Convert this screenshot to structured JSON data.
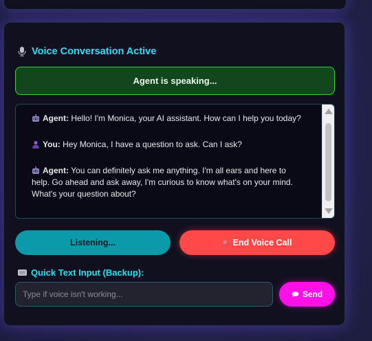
{
  "header": {
    "title": "Voice Conversation Active",
    "icon": "microphone-icon"
  },
  "status": {
    "text": "Agent is speaking..."
  },
  "transcript": {
    "messages": [
      {
        "speaker": "Agent:",
        "avatar": "robot-icon",
        "text": "Hello! I'm Monica, your AI assistant. How can I help you today?"
      },
      {
        "speaker": "You:",
        "avatar": "user-icon",
        "text": "Hey Monica, I have a question to ask. Can I ask?"
      },
      {
        "speaker": "Agent:",
        "avatar": "robot-icon",
        "text": "You can definitely ask me anything. I'm all ears and here to help. Go ahead and ask away, I'm curious to know what's on your mind. What's your question about?"
      }
    ]
  },
  "controls": {
    "listening_label": "Listening...",
    "end_call_label": "End Voice Call"
  },
  "quick_input": {
    "label": "Quick Text Input (Backup):",
    "placeholder": "Type if voice isn't working...",
    "value": "",
    "send_label": "Send"
  },
  "colors": {
    "accent_cyan": "#22e4f4",
    "status_green": "#3ccf3c",
    "listening_teal": "#0b9aaa",
    "end_call_red": "#ff4848",
    "send_magenta": "#ff10e8"
  }
}
